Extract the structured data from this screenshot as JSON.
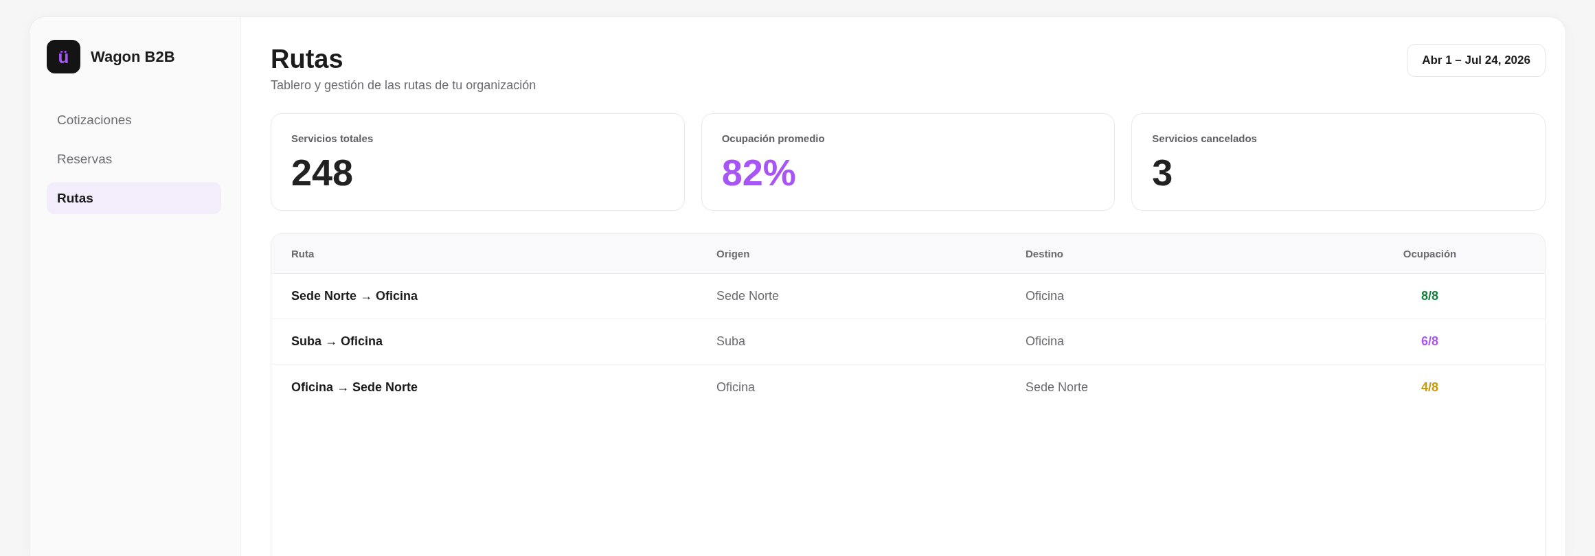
{
  "sidebar": {
    "logo": "ü",
    "brand": "Wagon B2B",
    "items": [
      {
        "label": "Cotizaciones",
        "selected": false
      },
      {
        "label": "Reservas",
        "selected": false
      },
      {
        "label": "Rutas",
        "selected": true
      }
    ]
  },
  "header": {
    "title": "Rutas",
    "subtitle": "Tablero y gestión de las rutas de tu organización",
    "date_range": "Abr 1 – Jul 24, 2026"
  },
  "stats": [
    {
      "label": "Servicios totales",
      "value": "248",
      "color": "#222222"
    },
    {
      "label": "Ocupación promedio",
      "value": "82%",
      "color": "#a855f7"
    },
    {
      "label": "Servicios cancelados",
      "value": "3",
      "color": "#222222"
    }
  ],
  "table": {
    "columns": [
      "Ruta",
      "Origen",
      "Destino",
      "Ocupación"
    ],
    "rows": [
      {
        "route": "Sede Norte → Oficina",
        "origin": "Sede Norte",
        "destination": "Oficina",
        "occupancy": "8/8",
        "color": "#15803d"
      },
      {
        "route": "Suba → Oficina",
        "origin": "Suba",
        "destination": "Oficina",
        "occupancy": "6/8",
        "color": "#a855f7"
      },
      {
        "route": "Oficina → Sede Norte",
        "origin": "Oficina",
        "destination": "Sede Norte",
        "occupancy": "4/8",
        "color": "#c99a06"
      }
    ]
  }
}
